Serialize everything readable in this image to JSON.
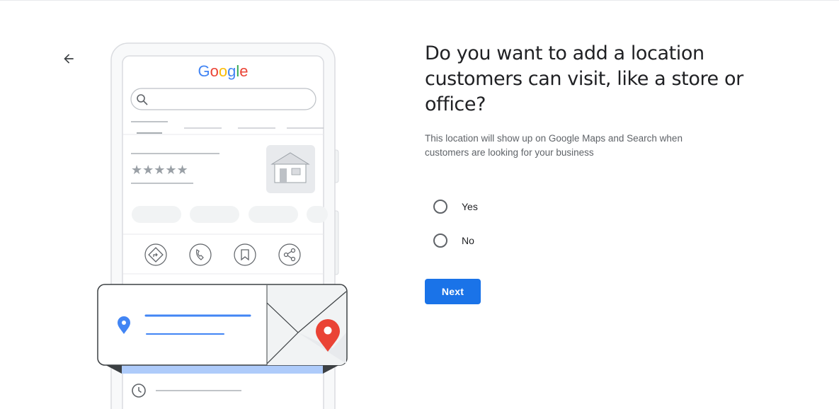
{
  "header": {
    "back_icon": "arrow-back-icon"
  },
  "illustration": {
    "logo_text": "Google",
    "logo_colors": [
      "#4285f4",
      "#ea4335",
      "#fbbc05",
      "#4285f4",
      "#34a853",
      "#ea4335"
    ],
    "rating_stars": 5,
    "action_icons": [
      "directions-icon",
      "phone-icon",
      "bookmark-icon",
      "share-icon"
    ],
    "pin_colors": {
      "blue": "#4285f4",
      "red": "#ea4335"
    }
  },
  "main": {
    "question": "Do you want to add a location customers can visit, like a store or office?",
    "description": "This location will show up on Google Maps and Search when customers are looking for your business",
    "options": [
      {
        "label": "Yes",
        "selected": false
      },
      {
        "label": "No",
        "selected": false
      }
    ],
    "next_label": "Next"
  },
  "colors": {
    "accent": "#1a73e8",
    "text_primary": "#202124",
    "text_secondary": "#5f6368"
  }
}
